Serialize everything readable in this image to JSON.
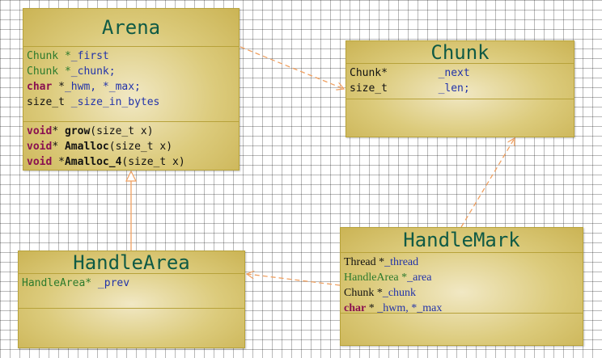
{
  "classes": {
    "arena": {
      "name": "Arena",
      "fields": [
        [
          {
            "t": "Chunk *",
            "s": "green"
          },
          {
            "t": "_first",
            "s": "blue"
          }
        ],
        [
          {
            "t": "Chunk *",
            "s": "green"
          },
          {
            "t": "_chunk;",
            "s": "blue"
          }
        ],
        [
          {
            "t": "char",
            "s": "kw"
          },
          {
            "t": " *",
            "s": "black"
          },
          {
            "t": "_hwm, *_max;",
            "s": "blue"
          }
        ],
        [
          {
            "t": "size_t ",
            "s": "black"
          },
          {
            "t": "_size_in_bytes",
            "s": "blue"
          }
        ]
      ],
      "methods": [
        [
          {
            "t": "void",
            "s": "kw"
          },
          {
            "t": "* ",
            "s": "black"
          },
          {
            "t": "grow",
            "s": "bold"
          },
          {
            "t": "(size_t x)",
            "s": "black"
          }
        ],
        [
          {
            "t": "void",
            "s": "kw"
          },
          {
            "t": "* ",
            "s": "black"
          },
          {
            "t": "Amalloc",
            "s": "bold"
          },
          {
            "t": "(size_t x)",
            "s": "black"
          }
        ],
        [
          {
            "t": "void",
            "s": "kw"
          },
          {
            "t": " *",
            "s": "black"
          },
          {
            "t": "Amalloc_4",
            "s": "bold"
          },
          {
            "t": "(size_t x)",
            "s": "black"
          }
        ]
      ]
    },
    "chunk": {
      "name": "Chunk",
      "fields": [
        [
          {
            "t": "Chunk*        ",
            "s": "black"
          },
          {
            "t": "_next",
            "s": "blue"
          }
        ],
        [
          {
            "t": "size_t        ",
            "s": "black"
          },
          {
            "t": "_len;",
            "s": "blue"
          }
        ]
      ],
      "methods": []
    },
    "handlearea": {
      "name": "HandleArea",
      "fields": [
        [
          {
            "t": "HandleArea* ",
            "s": "green"
          },
          {
            "t": "_prev",
            "s": "blue"
          }
        ]
      ],
      "methods": []
    },
    "handlemark": {
      "name": "HandleMark",
      "fields": [
        [
          {
            "t": "Thread *",
            "s": "black"
          },
          {
            "t": "_thread",
            "s": "blue"
          }
        ],
        [
          {
            "t": "HandleArea *",
            "s": "green"
          },
          {
            "t": "_area",
            "s": "blue"
          }
        ],
        [
          {
            "t": "Chunk *",
            "s": "black"
          },
          {
            "t": "_chunk",
            "s": "blue"
          }
        ],
        [
          {
            "t": "char",
            "s": "kw"
          },
          {
            "t": " * ",
            "s": "black"
          },
          {
            "t": "_hwm, *_max",
            "s": "blue"
          }
        ]
      ],
      "methods": []
    }
  },
  "colors": {
    "connector": "#f0a060",
    "title": "#0f5a45",
    "border": "#b7a23a"
  }
}
